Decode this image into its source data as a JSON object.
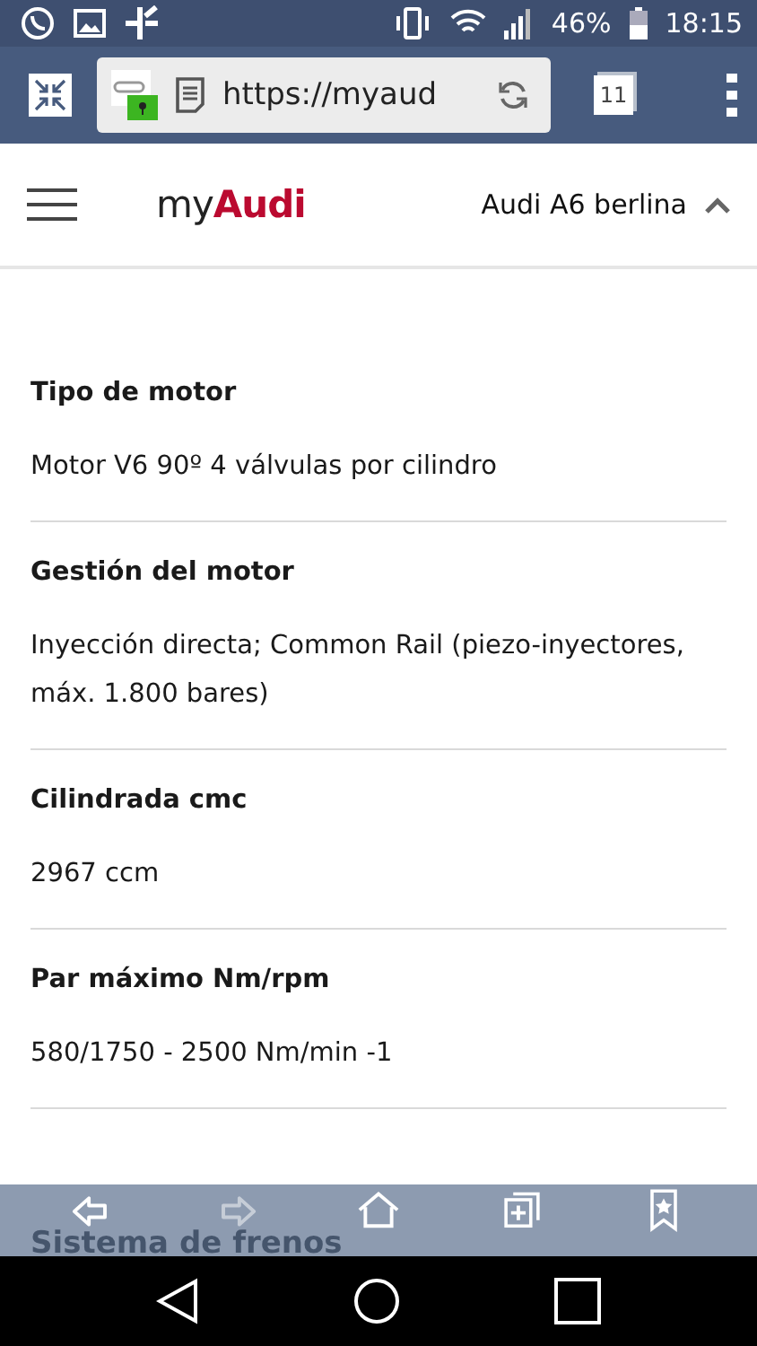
{
  "status_bar": {
    "battery": "46%",
    "time": "18:15"
  },
  "browser": {
    "url": "https://myaud",
    "tab_count": "11"
  },
  "header": {
    "logo_prefix": "my",
    "logo_brand": "Audi",
    "model": "Audi A6 berlina",
    "expanded": true
  },
  "specs": [
    {
      "label": "Tipo de motor",
      "value": "Motor V6 90º 4 válvulas por cilindro"
    },
    {
      "label": "Gestión del motor",
      "value": "Inyección directa; Common Rail (piezo-inyectores, máx. 1.800 bares)"
    },
    {
      "label": "Cilindrada cmc",
      "value": "2967 ccm"
    },
    {
      "label": "Par máximo Nm/rpm",
      "value": "580/1750 - 2500 Nm/min -1"
    }
  ],
  "next_section": "Sistema de frenos",
  "toolbar": [
    {
      "kind": "back",
      "disabled": false
    },
    {
      "kind": "forward",
      "disabled": true
    },
    {
      "kind": "home",
      "disabled": false
    },
    {
      "kind": "new-tab",
      "disabled": false
    },
    {
      "kind": "bookmarks",
      "disabled": false
    }
  ]
}
